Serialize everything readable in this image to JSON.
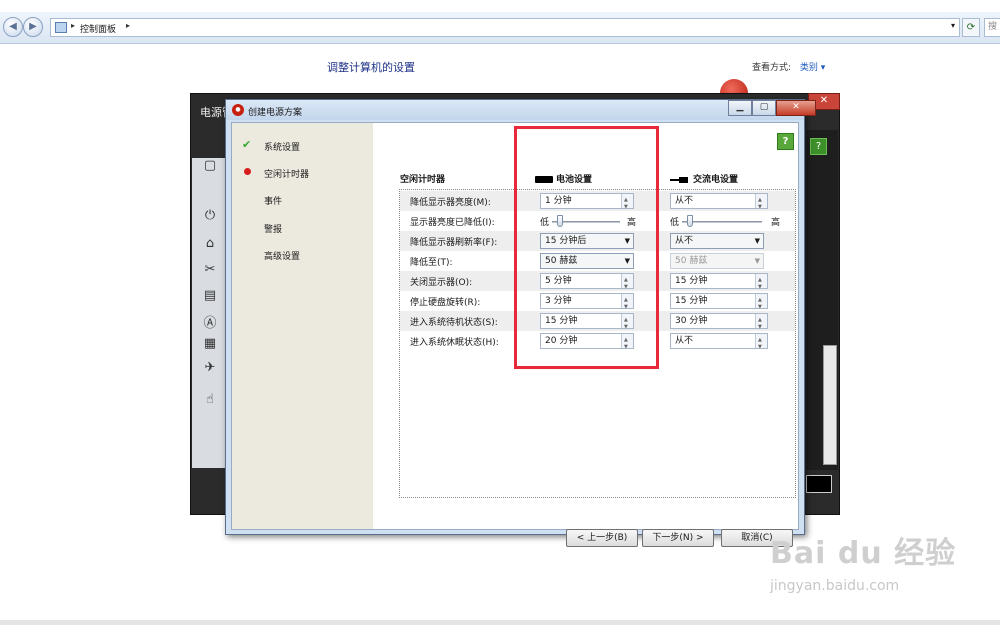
{
  "explorer": {
    "breadcrumb": "控制面板",
    "search_placeholder": "搜",
    "title": "调整计算机的设置",
    "view_by_label": "查看方式:",
    "view_by_value": "类别"
  },
  "background_window": {
    "title": "电源管"
  },
  "dialog": {
    "title": "创建电源方案",
    "nav": [
      "系统设置",
      "空闲计时器",
      "事件",
      "警报",
      "高级设置"
    ],
    "section_label": "空闲计时器",
    "battery_header": "电池设置",
    "ac_header": "交流电设置",
    "rows": [
      {
        "label": "降低显示器亮度(M):",
        "battery": "1 分钟",
        "ac": "从不",
        "type": "spin"
      },
      {
        "label": "显示器亮度已降低(I):",
        "low": "低",
        "high": "高",
        "type": "slider",
        "battery_level": 0.05,
        "ac_level": 0.05
      },
      {
        "label": "降低显示器刷新率(F):",
        "battery": "15 分钟后",
        "ac": "从不",
        "type": "select"
      },
      {
        "label": "降低至(T):",
        "battery": "50 赫兹",
        "ac": "50 赫兹",
        "type": "select-disabled-ac"
      },
      {
        "label": "关闭显示器(O):",
        "battery": "5 分钟",
        "ac": "15 分钟",
        "type": "spin"
      },
      {
        "label": "停止硬盘旋转(R):",
        "battery": "3 分钟",
        "ac": "15 分钟",
        "type": "spin"
      },
      {
        "label": "进入系统待机状态(S):",
        "battery": "15 分钟",
        "ac": "30 分钟",
        "type": "spin"
      },
      {
        "label": "进入系统休眠状态(H):",
        "battery": "20 分钟",
        "ac": "从不",
        "type": "spin"
      }
    ],
    "buttons": {
      "back": "< 上一步(B)",
      "next": "下一步(N) >",
      "cancel": "取消(C)"
    },
    "help": "?"
  },
  "watermark": {
    "main": "Bai du 经验",
    "sub": "jingyan.baidu.com"
  },
  "colors": {
    "highlight_box": "#e8293a",
    "help_green": "#5aa83c",
    "title_blue": "#1e3287"
  }
}
